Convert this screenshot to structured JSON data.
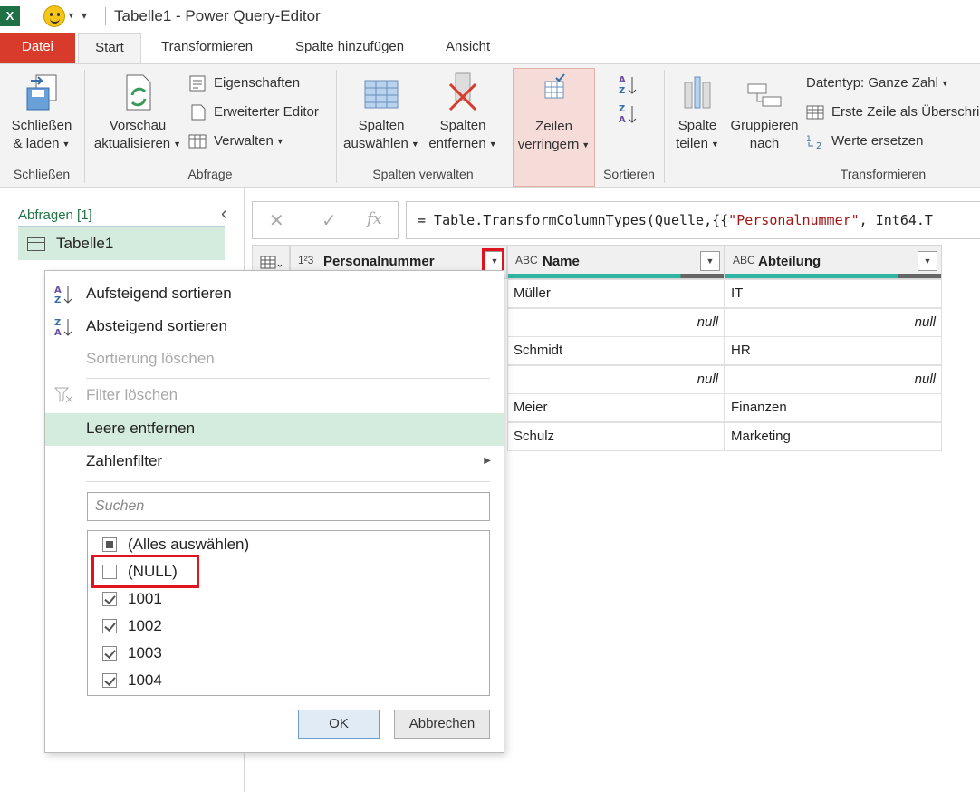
{
  "window": {
    "title": "Tabelle1 - Power Query-Editor",
    "app_icon": "excel-icon"
  },
  "tabs": [
    {
      "label": "Datei"
    },
    {
      "label": "Start"
    },
    {
      "label": "Transformieren"
    },
    {
      "label": "Spalte hinzufügen"
    },
    {
      "label": "Ansicht"
    }
  ],
  "ribbon": {
    "groups": {
      "schliessen": "Schließen",
      "abfrage": "Abfrage",
      "spalten_verwalten": "Spalten verwalten",
      "sortieren": "Sortieren",
      "transformieren": "Transformieren"
    },
    "close_load": {
      "line1": "Schließen",
      "line2": "& laden"
    },
    "refresh": {
      "line1": "Vorschau",
      "line2": "aktualisieren"
    },
    "properties": "Eigenschaften",
    "advanced_editor": "Erweiterter Editor",
    "manage": "Verwalten",
    "choose_columns": {
      "line1": "Spalten",
      "line2": "auswählen"
    },
    "remove_columns": {
      "line1": "Spalten",
      "line2": "entfernen"
    },
    "reduce_rows": {
      "line1": "Zeilen",
      "line2": "verringern"
    },
    "split_column": {
      "line1": "Spalte",
      "line2": "teilen"
    },
    "group_by": {
      "line1": "Gruppieren",
      "line2": "nach"
    },
    "data_type": "Datentyp: Ganze Zahl",
    "first_row_header": "Erste Zeile als Überschri",
    "replace_values": "Werte ersetzen"
  },
  "queries": {
    "header": "Abfragen [1]",
    "items": [
      "Tabelle1"
    ]
  },
  "formula": {
    "prefix": "= Table.TransformColumnTypes(Quelle,{{",
    "str": "\"Personalnummer\"",
    "suffix": ", Int64.T"
  },
  "columns": [
    {
      "type": "1²3",
      "name": "Personalnummer"
    },
    {
      "type": "ABC",
      "name": "Name"
    },
    {
      "type": "ABC",
      "name": "Abteilung"
    }
  ],
  "rows": [
    [
      "Müller",
      "IT"
    ],
    [
      "null",
      "null"
    ],
    [
      "Schmidt",
      "HR"
    ],
    [
      "null",
      "null"
    ],
    [
      "Meier",
      "Finanzen"
    ],
    [
      "Schulz",
      "Marketing"
    ]
  ],
  "menu": {
    "sort_asc": "Aufsteigend sortieren",
    "sort_desc": "Absteigend sortieren",
    "clear_sort": "Sortierung löschen",
    "clear_filter": "Filter löschen",
    "remove_empty": "Leere entfernen",
    "number_filters": "Zahlenfilter",
    "search_placeholder": "Suchen",
    "select_all": "(Alles auswählen)",
    "values": [
      "(NULL)",
      "1001",
      "1002",
      "1003",
      "1004"
    ],
    "ok": "OK",
    "cancel": "Abbrechen"
  }
}
